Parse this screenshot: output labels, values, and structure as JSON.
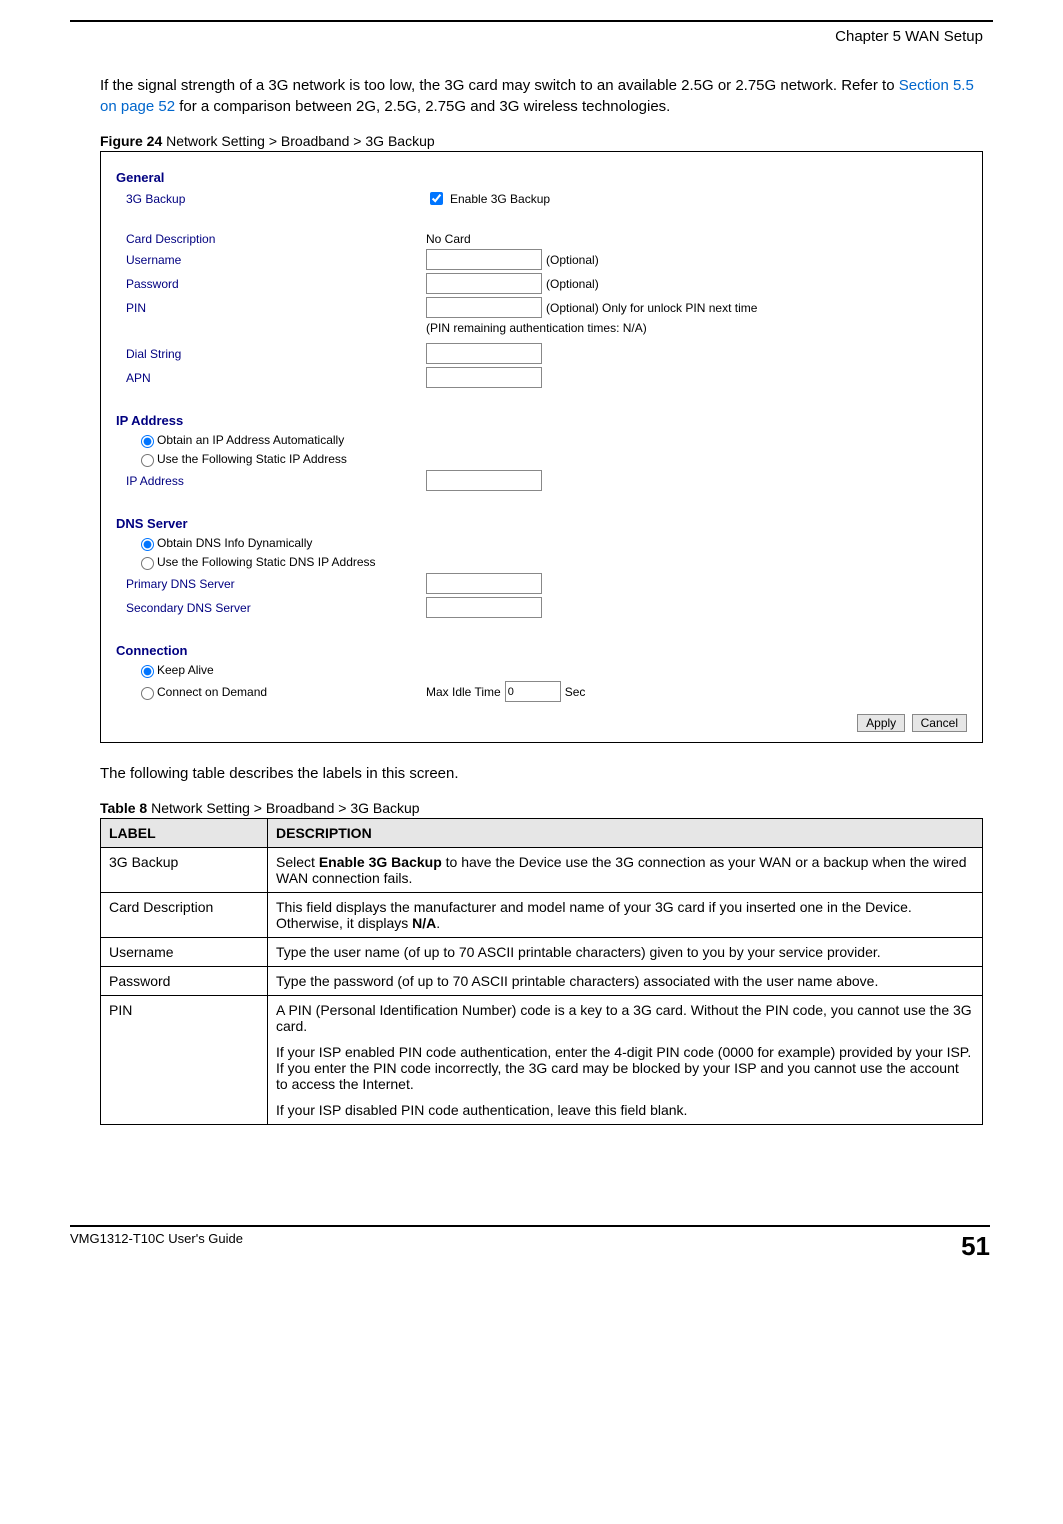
{
  "header": {
    "chapter": "Chapter 5 WAN Setup"
  },
  "intro": {
    "p1a": "If the signal strength of a 3G network is too low, the 3G card may switch to an available 2.5G or 2.75G network. Refer to ",
    "p1link": "Section 5.5 on page 52",
    "p1b": " for a comparison between 2G, 2.5G, 2.75G and 3G wireless technologies."
  },
  "figure": {
    "num": "Figure 24",
    "title": "   Network Setting > Broadband > 3G Backup"
  },
  "screenshot": {
    "general_head": "General",
    "backup_label": "3G Backup",
    "backup_checkbox": "Enable 3G Backup",
    "card_desc_label": "Card Description",
    "card_desc_value": "No Card",
    "username_label": "Username",
    "username_note": "(Optional)",
    "password_label": "Password",
    "password_note": "(Optional)",
    "pin_label": "PIN",
    "pin_note": "(Optional) Only for unlock PIN next time",
    "pin_remaining": "(PIN remaining authentication times: N/A)",
    "dial_label": "Dial String",
    "apn_label": "APN",
    "ip_head": "IP Address",
    "ip_auto": "Obtain an IP Address Automatically",
    "ip_static": "Use the Following Static IP Address",
    "ip_addr_label": "IP Address",
    "dns_head": "DNS Server",
    "dns_auto": "Obtain DNS Info Dynamically",
    "dns_static": "Use the Following Static DNS IP Address",
    "dns_primary_label": "Primary DNS Server",
    "dns_secondary_label": "Secondary DNS Server",
    "conn_head": "Connection",
    "keep_alive": "Keep Alive",
    "on_demand": "Connect on Demand",
    "max_idle_label": "Max Idle Time",
    "max_idle_value": "0",
    "sec_label": "Sec",
    "apply_btn": "Apply",
    "cancel_btn": "Cancel"
  },
  "tabledesc": {
    "intro": "The following table describes the labels in this screen.",
    "num": "Table 8",
    "title": "   Network Setting > Broadband > 3G Backup",
    "head_label": "LABEL",
    "head_desc": "DESCRIPTION",
    "rows": [
      {
        "label": "3G Backup",
        "desc": {
          "p1a": "Select ",
          "p1b": "Enable 3G Backup",
          "p1c": " to have the Device use the 3G connection as your WAN or a backup when the wired WAN connection fails."
        }
      },
      {
        "label": "Card Description",
        "desc": {
          "p1a": "This field displays the manufacturer and model name of your 3G card if you inserted one in the Device. Otherwise, it displays ",
          "p1b": "N/A",
          "p1c": "."
        }
      },
      {
        "label": "Username",
        "desc": "Type the user name (of up to 70 ASCII printable characters) given to you by your service provider."
      },
      {
        "label": "Password",
        "desc": "Type the password (of up to 70 ASCII printable characters) associated with the user name above."
      },
      {
        "label": "PIN",
        "desc": {
          "p1": "A PIN (Personal Identification Number) code is a key to a 3G card. Without the PIN code, you cannot use the 3G card.",
          "p2": "If your ISP enabled PIN code authentication, enter the 4-digit PIN code (0000 for example) provided by your ISP. If you enter the PIN code incorrectly, the 3G card may be blocked by your ISP and you cannot use the account to access the Internet.",
          "p3": "If your ISP disabled PIN code authentication, leave this field blank."
        }
      }
    ]
  },
  "footer": {
    "guide": "VMG1312-T10C User's Guide",
    "page": "51"
  }
}
